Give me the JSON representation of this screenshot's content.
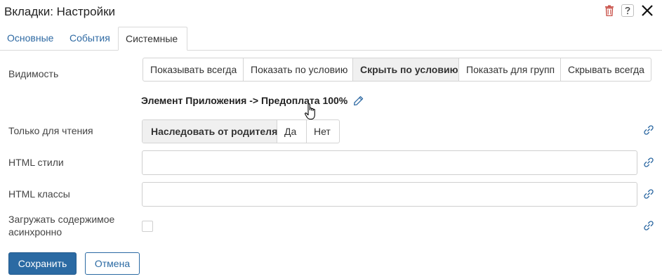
{
  "window": {
    "title": "Вкладки: Настройки",
    "icons": [
      "trash-icon",
      "help-icon",
      "close-icon"
    ]
  },
  "tabs": [
    {
      "label": "Основные",
      "active": false
    },
    {
      "label": "События",
      "active": false
    },
    {
      "label": "Системные",
      "active": true
    }
  ],
  "visibility": {
    "label": "Видимость",
    "options": [
      "Показывать всегда",
      "Показать по условию",
      "Скрыть по условию",
      "Показать для групп",
      "Скрывать всегда"
    ],
    "selected": "Скрыть по условию",
    "condition_text": "Элемент Приложения -> Предоплата 100%"
  },
  "readonly": {
    "label": "Только для чтения",
    "options": [
      "Наследовать от родителя",
      "Да",
      "Нет"
    ],
    "selected": "Наследовать от родителя"
  },
  "html_styles": {
    "label": "HTML стили",
    "value": "",
    "placeholder": ""
  },
  "html_classes": {
    "label": "HTML классы",
    "value": "",
    "placeholder": ""
  },
  "async_load": {
    "label_line1": "Загружать содержимое",
    "label_line2": "асинхронно",
    "checked": false
  },
  "buttons": {
    "save": "Сохранить",
    "cancel": "Отмена"
  },
  "colors": {
    "accent": "#2b6aa3",
    "link": "#2f6aa3",
    "trash": "#c9524a",
    "selected_segment_bg": "#f0f0f0"
  }
}
